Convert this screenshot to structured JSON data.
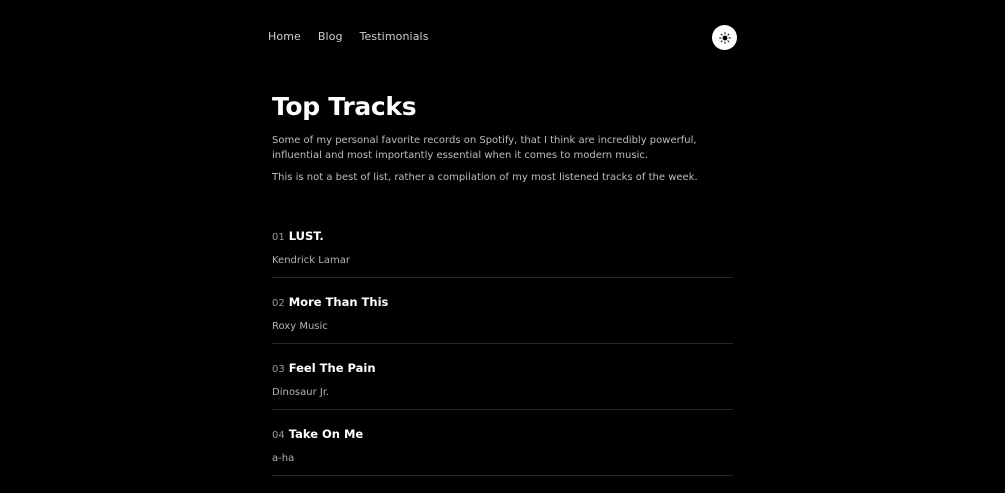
{
  "nav": {
    "items": [
      {
        "label": "Home"
      },
      {
        "label": "Blog"
      },
      {
        "label": "Testimonials"
      }
    ]
  },
  "theme_toggle": {
    "icon": "sun-icon"
  },
  "main": {
    "title": "Top Tracks",
    "description": "Some of my personal favorite records on Spotify, that I think are incredibly powerful, influential and most importantly essential when it comes to modern music.",
    "note": "This is not a best of list, rather a compilation of my most listened tracks of the week."
  },
  "tracks": [
    {
      "number": "01",
      "name": "LUST.",
      "artist": "Kendrick Lamar"
    },
    {
      "number": "02",
      "name": "More Than This",
      "artist": "Roxy Music"
    },
    {
      "number": "03",
      "name": "Feel The Pain",
      "artist": "Dinosaur Jr."
    },
    {
      "number": "04",
      "name": "Take On Me",
      "artist": "a-ha"
    }
  ],
  "colors": {
    "background": "#000000",
    "text": "#ffffff",
    "muted": "#bdbdbd",
    "divider": "#262626"
  }
}
